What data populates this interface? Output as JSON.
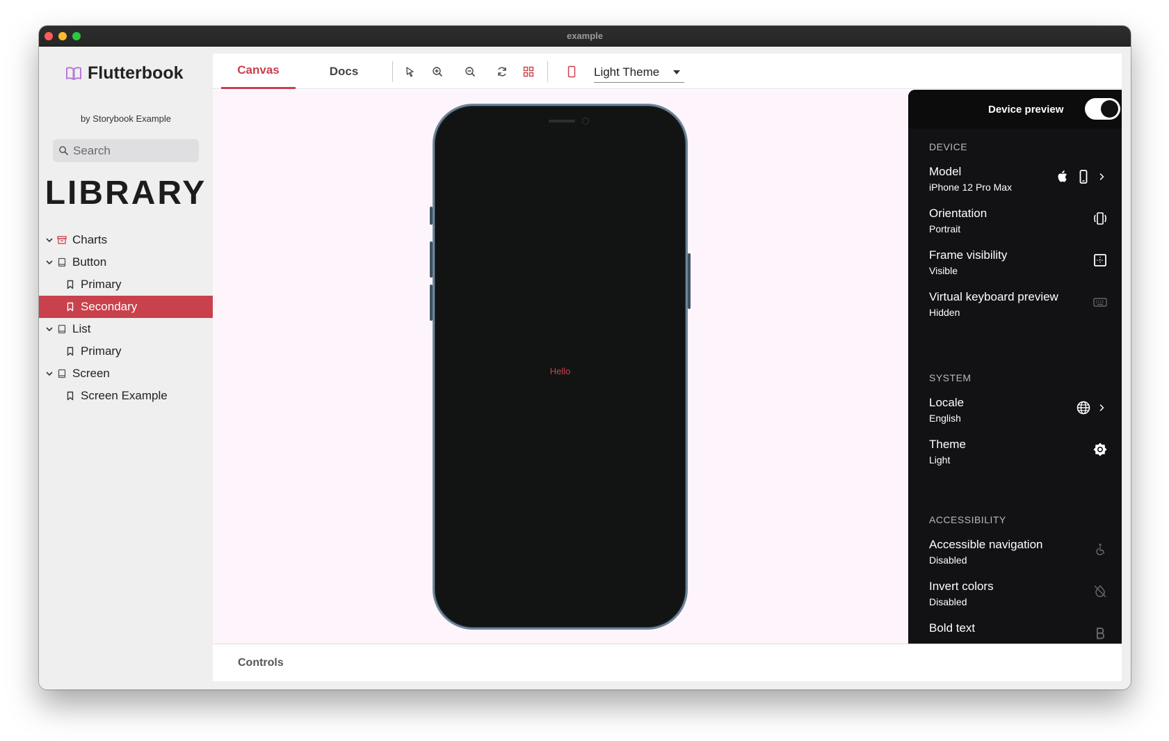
{
  "window": {
    "title": "example"
  },
  "sidebar": {
    "brand": "Flutterbook",
    "subtitle": "by Storybook Example",
    "search_placeholder": "Search",
    "library_heading": "LIBRARY",
    "items": [
      {
        "label": "Charts",
        "level": 0,
        "icon": "archive-icon",
        "expanded": true,
        "active": false
      },
      {
        "label": "Button",
        "level": 0,
        "icon": "component-icon",
        "expanded": true,
        "active": false
      },
      {
        "label": "Primary",
        "level": 1,
        "icon": "bookmark-icon",
        "active": false
      },
      {
        "label": "Secondary",
        "level": 1,
        "icon": "bookmark-icon",
        "active": true
      },
      {
        "label": "List",
        "level": 0,
        "icon": "component-icon",
        "expanded": true,
        "active": false
      },
      {
        "label": "Primary",
        "level": 1,
        "icon": "bookmark-icon",
        "active": false
      },
      {
        "label": "Screen",
        "level": 0,
        "icon": "component-icon",
        "expanded": true,
        "active": false
      },
      {
        "label": "Screen Example",
        "level": 1,
        "icon": "bookmark-icon",
        "active": false
      }
    ]
  },
  "toolbar": {
    "tabs": [
      {
        "label": "Canvas",
        "active": true
      },
      {
        "label": "Docs",
        "active": false
      }
    ],
    "tools": [
      "select-cursor-icon",
      "zoom-in-icon",
      "zoom-out-icon",
      "refresh-icon",
      "grid-icon",
      "device-frame-icon"
    ],
    "theme_select": "Light Theme"
  },
  "canvas": {
    "preview_text": "Hello"
  },
  "device_panel": {
    "header_label": "Device preview",
    "enabled": true,
    "sections": {
      "device": "DEVICE",
      "system": "SYSTEM",
      "accessibility": "ACCESSIBILITY"
    },
    "options": {
      "model": {
        "title": "Model",
        "value": "iPhone 12 Pro Max"
      },
      "orientation": {
        "title": "Orientation",
        "value": "Portrait"
      },
      "frame": {
        "title": "Frame visibility",
        "value": "Visible"
      },
      "keyboard": {
        "title": "Virtual keyboard preview",
        "value": "Hidden"
      },
      "locale": {
        "title": "Locale",
        "value": "English"
      },
      "theme": {
        "title": "Theme",
        "value": "Light"
      },
      "accessible_nav": {
        "title": "Accessible navigation",
        "value": "Disabled"
      },
      "invert": {
        "title": "Invert colors",
        "value": "Disabled"
      },
      "bold": {
        "title": "Bold text",
        "value": ""
      }
    }
  },
  "controls": {
    "label": "Controls"
  },
  "colors": {
    "accent": "#c9414c",
    "sidebar_bg": "#efeff0",
    "panel_bg": "#121214",
    "canvas_bg": "#fdf5fb",
    "phone_frame": "#6d8598"
  }
}
